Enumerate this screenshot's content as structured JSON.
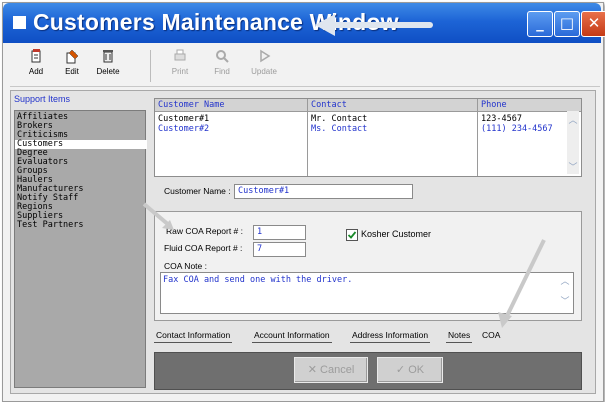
{
  "window": {
    "title": "Customers Maintenance Window"
  },
  "toolbar": {
    "add_label": "Add",
    "edit_label": "Edit",
    "delete_label": "Delete",
    "print_label": "Print",
    "find_label": "Find",
    "update_label": "Update"
  },
  "sidebar": {
    "title": "Support Items",
    "items": [
      {
        "label": "Affiliates"
      },
      {
        "label": "Brokers"
      },
      {
        "label": "Criticisms"
      },
      {
        "label": "Customers"
      },
      {
        "label": "Degree"
      },
      {
        "label": "Evaluators"
      },
      {
        "label": "Groups"
      },
      {
        "label": "Haulers"
      },
      {
        "label": "Manufacturers"
      },
      {
        "label": "Notify Staff"
      },
      {
        "label": "Regions"
      },
      {
        "label": "Suppliers"
      },
      {
        "label": "Test Partners"
      }
    ],
    "selected": "Customers"
  },
  "grid": {
    "headers": [
      "Customer Name",
      "Contact",
      "Phone"
    ],
    "rows": [
      [
        "Customer#1",
        "Mr. Contact",
        "123-4567"
      ],
      [
        "Customer#2",
        "Ms. Contact",
        "(111) 234-4567"
      ]
    ]
  },
  "form": {
    "customer_name_label": "Customer Name :",
    "customer_name_value": "Customer#1",
    "raw_coa_label": "Raw COA Report # :",
    "raw_coa_value": "1",
    "fluid_coa_label": "Fluid COA Report # :",
    "fluid_coa_value": "7",
    "kosher_label": "Kosher Customer",
    "kosher_checked": true,
    "coa_note_label": "COA Note :",
    "coa_note_value": "Fax COA and send one with the driver."
  },
  "tabs": [
    {
      "label": "Contact Information"
    },
    {
      "label": "Account Information"
    },
    {
      "label": "Address Information"
    },
    {
      "label": "Notes"
    },
    {
      "label": "COA"
    }
  ],
  "active_tab": "COA",
  "actions": {
    "cancel_label": "Cancel",
    "ok_label": "OK"
  },
  "colors": {
    "title_bar": "#1d64d6",
    "link_text": "#2233cc",
    "action_bar": "#6f6f6f"
  }
}
